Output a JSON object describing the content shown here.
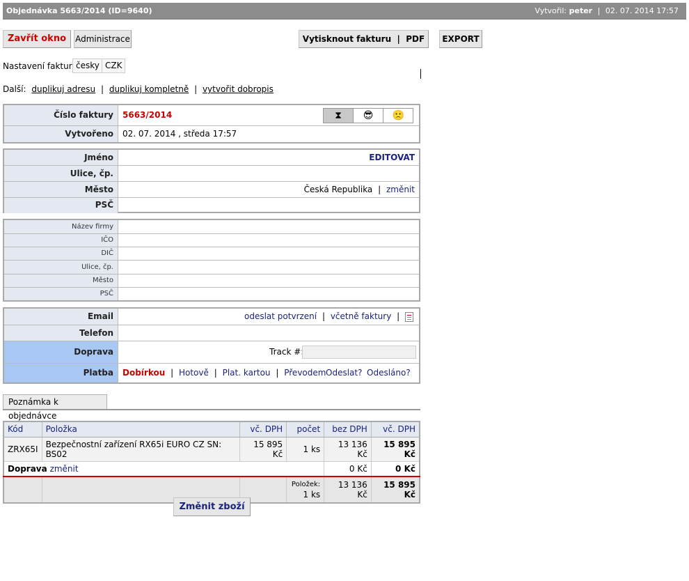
{
  "title": {
    "left": "Objednávka 5663/2014  (ID=9640)",
    "created_label": "Vytvořil:",
    "user": "peter",
    "sep": "|",
    "datetime": "02. 07. 2014 17:57"
  },
  "toolbar": {
    "close": "Zavřít okno",
    "admin": "Administrace",
    "print": "Vytisknout fakturu  |  PDF",
    "export": "EXPORT"
  },
  "settings": {
    "label": "Nastavení faktury:",
    "lang": "česky",
    "currency": "CZK"
  },
  "dalsi": {
    "label": "Další:",
    "links": [
      "duplikuj adresu",
      "duplikuj kompletně",
      "vytvořit dobropis"
    ],
    "sep": "|"
  },
  "invoice": {
    "number_label": "Číslo faktury",
    "number": "5663/2014",
    "created_label": "Vytvořeno",
    "created": "02. 07. 2014 , středa 17:57"
  },
  "address": {
    "name_label": "Jméno",
    "edit": "EDITOVAT",
    "street_label": "Ulice, čp.",
    "city_label": "Město",
    "country": "Česká Republika",
    "sep": "|",
    "change": "změnit",
    "zip_label": "PSČ"
  },
  "company": {
    "name_label": "Název firmy",
    "ico_label": "IČO",
    "dic_label": "DIČ",
    "street_label": "Ulice, čp.",
    "city_label": "Město",
    "zip_label": "PSČ"
  },
  "contact": {
    "email_label": "Email",
    "send_confirm": "odeslat potvrzení",
    "incl_invoice": "včetně faktury",
    "sep": "|",
    "phone_label": "Telefon",
    "shipping_label": "Doprava",
    "track_label": "Track #:",
    "payment_label": "Platba",
    "payments": [
      "Dobírkou",
      "Hotově",
      "Plat. kartou",
      "Převodem"
    ],
    "send_q": "Odeslat?",
    "sent_q": "Odesláno?"
  },
  "note_tab": "Poznámka k objednávce",
  "items": {
    "headers": [
      "Kód",
      "Položka",
      "vč. DPH",
      "počet",
      "bez DPH",
      "vč. DPH"
    ],
    "rows": [
      {
        "code": "ZRX65I",
        "name": "Bezpečnostní zařízení RX65i EURO CZ SN: BS02",
        "price_vat": "15 895 Kč",
        "qty": "1 ks",
        "total_novat": "13 136 Kč",
        "total_vat": "15 895 Kč"
      }
    ],
    "shipping": {
      "label": "Doprava",
      "change": "změnit",
      "novat": "0 Kč",
      "vat": "0 Kč"
    },
    "summary": {
      "count_label": "Položek:",
      "count": "1 ks",
      "novat": "13 136 Kč",
      "vat": "15 895 Kč"
    }
  },
  "change_goods": "Změnit zboží"
}
